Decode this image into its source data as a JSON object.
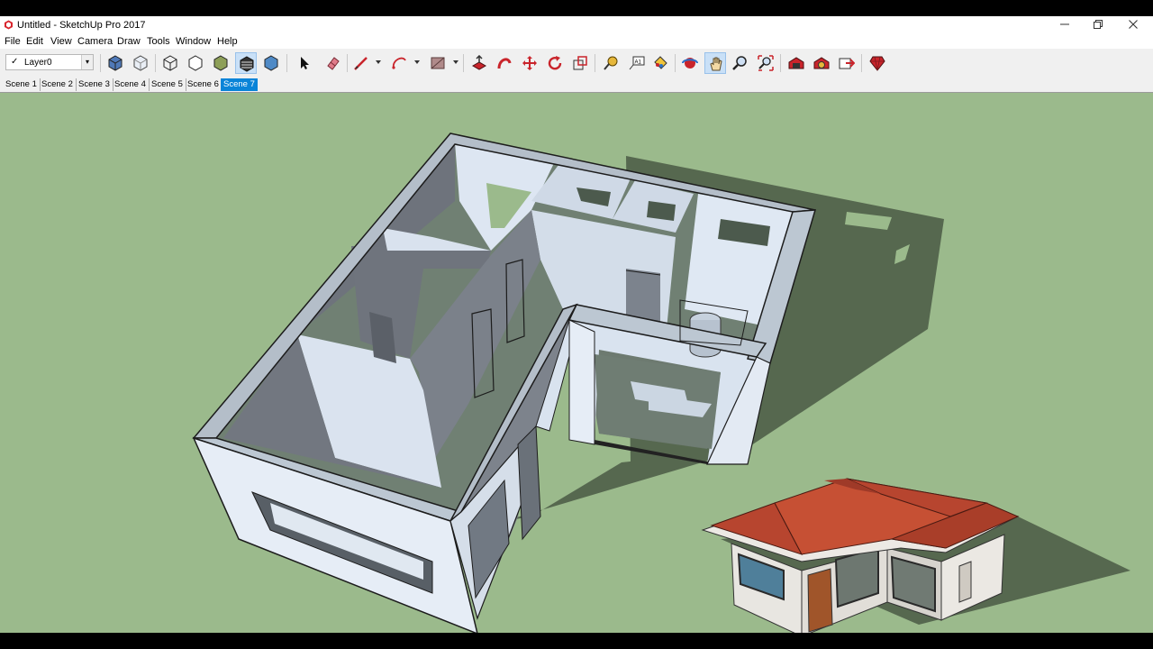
{
  "window": {
    "title": "Untitled - SketchUp Pro 2017"
  },
  "menu": [
    "File",
    "Edit",
    "View",
    "Camera",
    "Draw",
    "Tools",
    "Window",
    "Help"
  ],
  "toolbar": {
    "layer": {
      "checkmark": "✓",
      "name": "Layer0"
    },
    "tools": [
      "iso-view-icon",
      "xray-icon",
      "wireframe-icon",
      "hidden-line-icon",
      "shaded-icon",
      "shaded-textures-icon",
      "monochrome-icon",
      "select-icon",
      "eraser-icon",
      "line-icon",
      "arc-icon",
      "rectangle-icon",
      "push-pull-icon",
      "follow-me-icon",
      "move-icon",
      "rotate-icon",
      "scale-icon",
      "tape-measure-icon",
      "text-icon",
      "paint-bucket-icon",
      "orbit-icon",
      "pan-icon",
      "zoom-icon",
      "zoom-extents-icon",
      "warehouse-icon",
      "extension-warehouse-icon",
      "send-to-layout-icon",
      "ruby-console-icon"
    ]
  },
  "scenes": {
    "tabs": [
      "Scene 1",
      "Scene 2",
      "Scene 3",
      "Scene 4",
      "Scene 5",
      "Scene 6",
      "Scene 7"
    ],
    "active": "Scene 7"
  },
  "colors": {
    "viewport_background": "#9bba8c",
    "shadow": "#56684f",
    "roof": "#b7452f",
    "active_tab": "#0a84d8"
  }
}
